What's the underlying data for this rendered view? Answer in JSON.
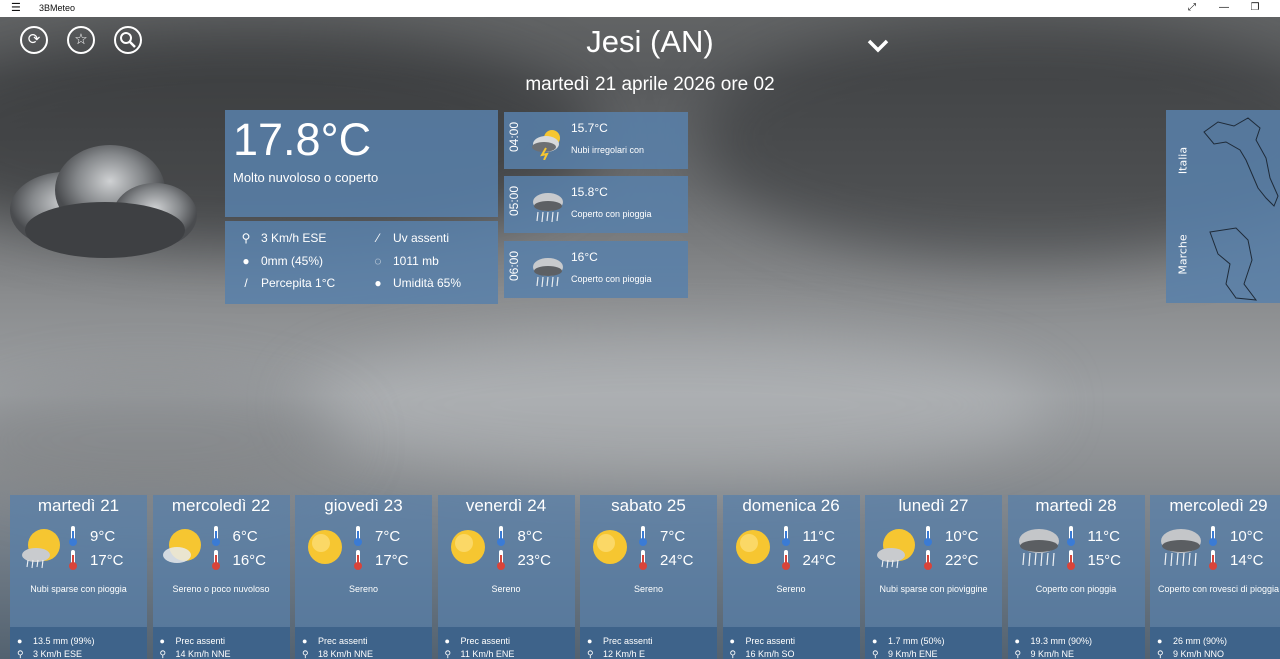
{
  "window": {
    "app_name": "3BMeteo"
  },
  "header": {
    "location": "Jesi (AN)",
    "datetime": "martedì 21 aprile 2026 ore 02"
  },
  "toolbar_icons": [
    "refresh-icon",
    "star-icon",
    "search-icon"
  ],
  "current": {
    "temperature": "17.8°C",
    "description": "Molto nuvoloso o coperto",
    "wind": "3 Km/h ESE",
    "uv": "Uv assenti",
    "precip": "0mm (45%)",
    "pressure": "1011 mb",
    "perceived": "Percepita 1°C",
    "humidity": "Umidità 65%"
  },
  "hourly": [
    {
      "hour": "04:00",
      "temp": "15.7°C",
      "desc": "Nubi irregolari con possibile temporale",
      "icon": "storm-icon"
    },
    {
      "hour": "05:00",
      "temp": "15.8°C",
      "desc": "Coperto con pioggia",
      "icon": "rain-icon"
    },
    {
      "hour": "06:00",
      "temp": "16°C",
      "desc": "Coperto con pioggia",
      "icon": "rain-icon"
    }
  ],
  "map": {
    "country": "Italia",
    "region": "Marche"
  },
  "daily": [
    {
      "day": "martedì 21",
      "min": "9°C",
      "max": "17°C",
      "desc": "Nubi sparse con pioggia",
      "prec": "13.5 mm (99%)",
      "wind": "3 Km/h ESE",
      "icon": "sun-rain-icon"
    },
    {
      "day": "mercoledì 22",
      "min": "6°C",
      "max": "16°C",
      "desc": "Sereno o poco nuvoloso",
      "prec": "Prec assenti",
      "wind": "14 Km/h NNE",
      "icon": "sun-cloud-icon"
    },
    {
      "day": "giovedì 23",
      "min": "7°C",
      "max": "17°C",
      "desc": "Sereno",
      "prec": "Prec assenti",
      "wind": "18 Km/h NNE",
      "icon": "sun-icon"
    },
    {
      "day": "venerdì 24",
      "min": "8°C",
      "max": "23°C",
      "desc": "Sereno",
      "prec": "Prec assenti",
      "wind": "11 Km/h ENE",
      "icon": "sun-icon"
    },
    {
      "day": "sabato 25",
      "min": "7°C",
      "max": "24°C",
      "desc": "Sereno",
      "prec": "Prec assenti",
      "wind": "12 Km/h E",
      "icon": "sun-icon"
    },
    {
      "day": "domenica 26",
      "min": "11°C",
      "max": "24°C",
      "desc": "Sereno",
      "prec": "Prec assenti",
      "wind": "16 Km/h SO",
      "icon": "sun-icon"
    },
    {
      "day": "lunedì 27",
      "min": "10°C",
      "max": "22°C",
      "desc": "Nubi sparse con pioviggine",
      "prec": "1.7 mm (50%)",
      "wind": "9 Km/h ENE",
      "icon": "sun-rain-icon"
    },
    {
      "day": "martedì 28",
      "min": "11°C",
      "max": "15°C",
      "desc": "Coperto con pioggia",
      "prec": "19.3 mm (90%)",
      "wind": "9 Km/h NE",
      "icon": "rain-icon"
    },
    {
      "day": "mercoledì 29",
      "min": "10°C",
      "max": "14°C",
      "desc": "Coperto con rovesci di pioggia",
      "prec": "26 mm (90%)",
      "wind": "9 Km/h NNO",
      "icon": "rain-icon"
    }
  ],
  "colors": {
    "panel": "#5880aa",
    "sun": "#f6c631",
    "thermo_min": "#3a7bd5",
    "thermo_max": "#d9443a"
  }
}
